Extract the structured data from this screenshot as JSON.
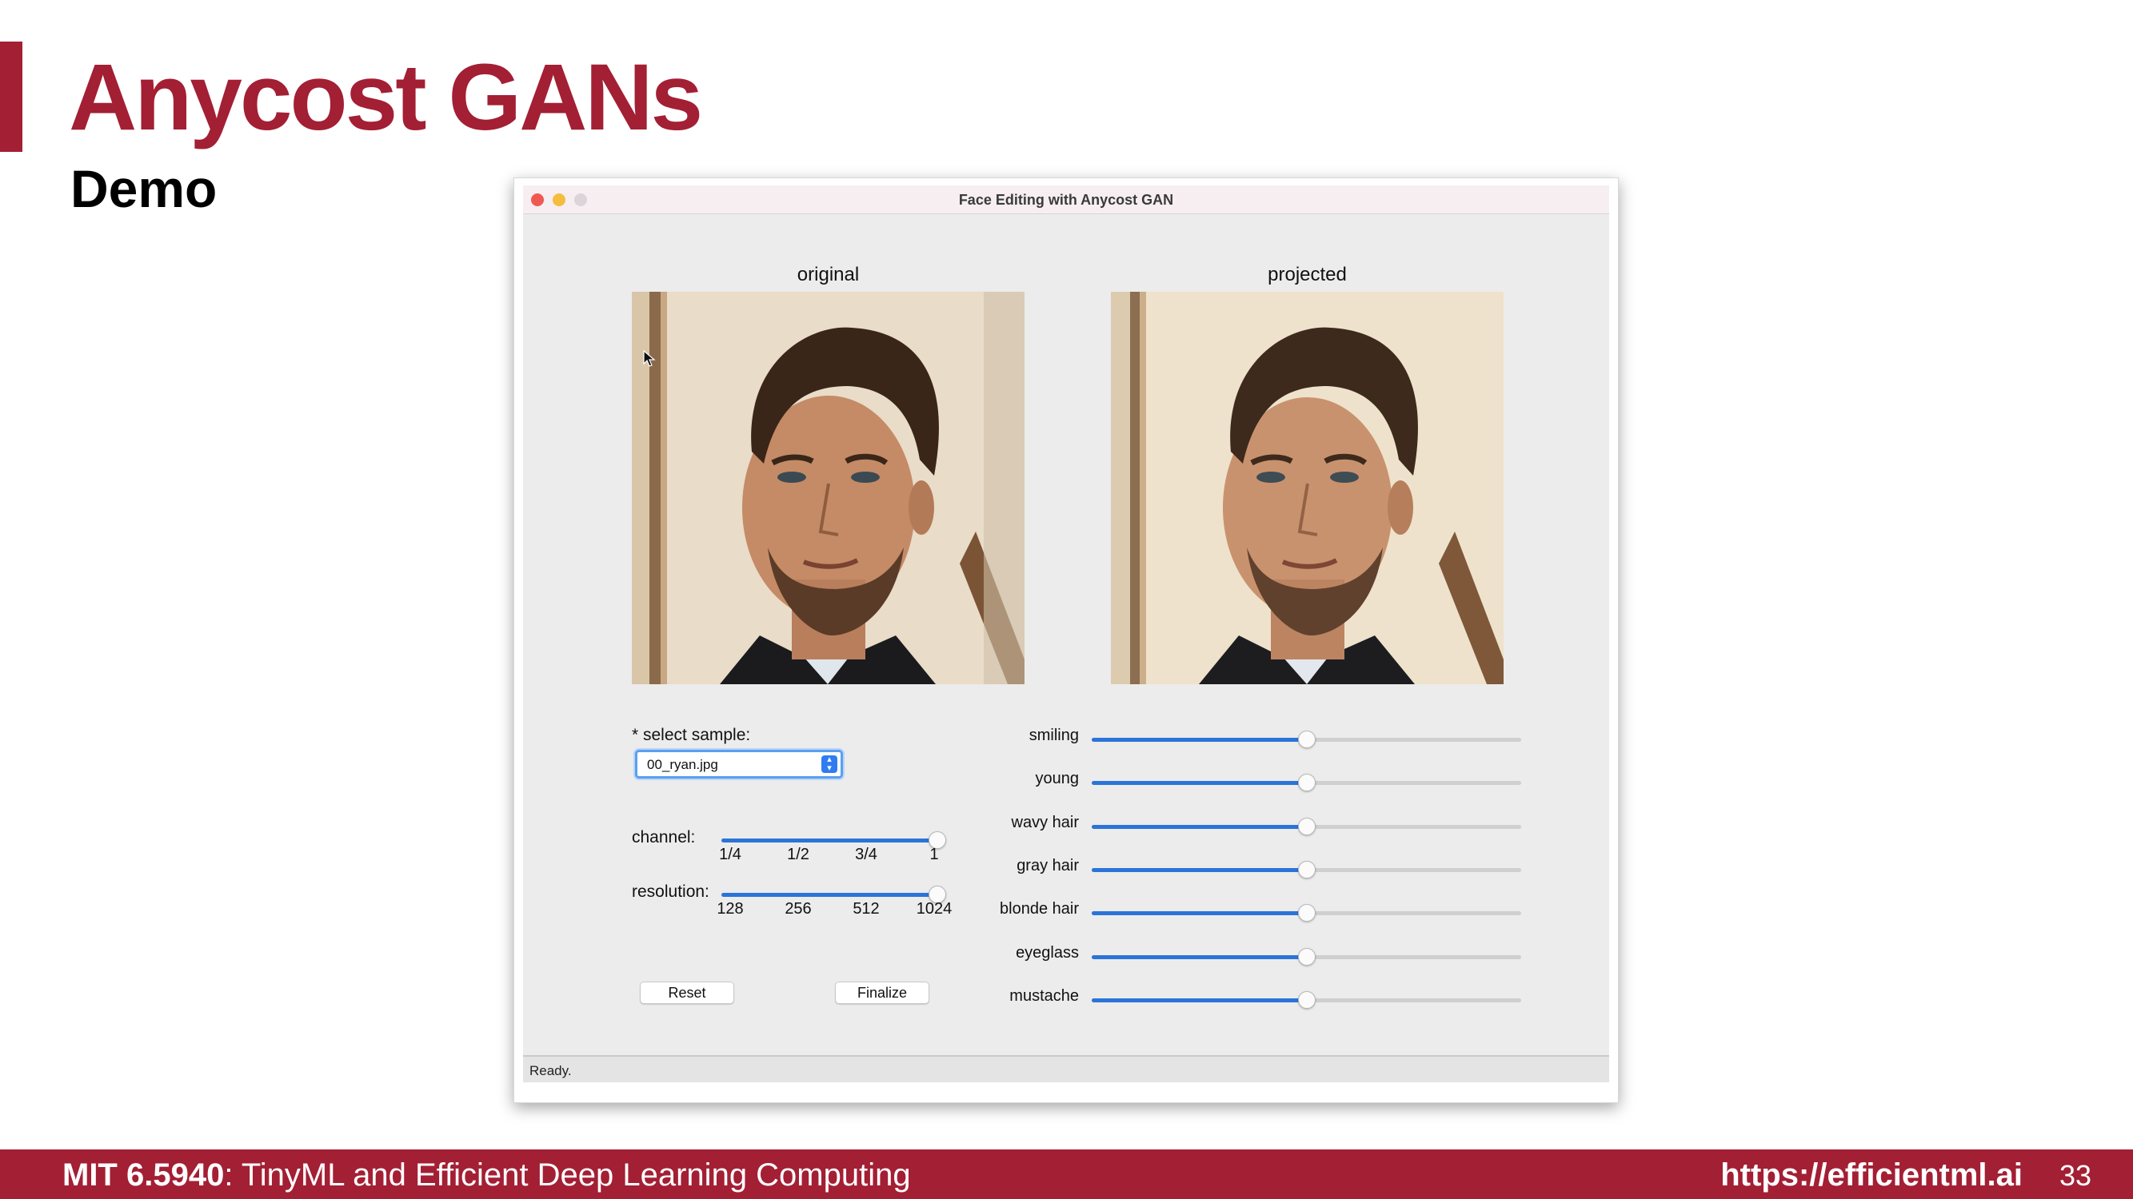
{
  "slide": {
    "title": "Anycost GANs",
    "subtitle": "Demo"
  },
  "window": {
    "title": "Face Editing with Anycost GAN",
    "status": "Ready."
  },
  "images": {
    "original_label": "original",
    "projected_label": "projected"
  },
  "sample": {
    "label": "* select sample:",
    "value": "00_ryan.jpg"
  },
  "channel": {
    "label": "channel:",
    "ticks": [
      "1/4",
      "1/2",
      "3/4",
      "1"
    ],
    "selected": "1",
    "level": 1.0
  },
  "resolution": {
    "label": "resolution:",
    "ticks": [
      "128",
      "256",
      "512",
      "1024"
    ],
    "selected": "1024",
    "level": 1.0
  },
  "buttons": {
    "reset": "Reset",
    "finalize": "Finalize"
  },
  "attributes": [
    {
      "label": "smiling",
      "level": 0.5
    },
    {
      "label": "young",
      "level": 0.5
    },
    {
      "label": "wavy hair",
      "level": 0.5
    },
    {
      "label": "gray hair",
      "level": 0.5
    },
    {
      "label": "blonde hair",
      "level": 0.5
    },
    {
      "label": "eyeglass",
      "level": 0.5
    },
    {
      "label": "mustache",
      "level": 0.5
    }
  ],
  "footer": {
    "course_code": "MIT 6.5940",
    "course_name": ": TinyML and Efficient Deep Learning Computing",
    "url": "https://efficientml.ai",
    "page": "33"
  },
  "colors": {
    "brand": "#a31f34",
    "slider_fill": "#2a74d8",
    "select_focus": "#5a9ff0"
  }
}
